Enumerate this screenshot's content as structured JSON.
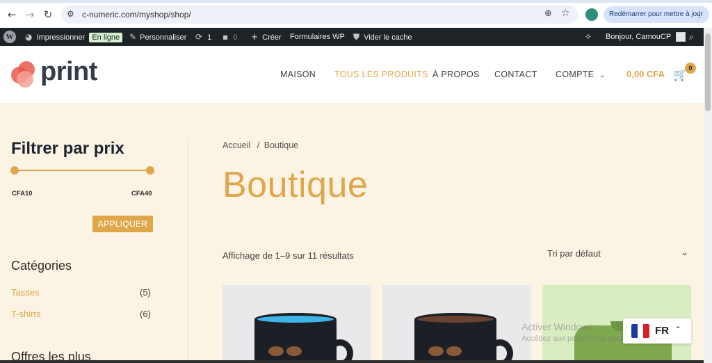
{
  "browser": {
    "back_icon": "arrow-left-icon",
    "forward_icon": "arrow-right-icon",
    "reload_icon": "reload-icon",
    "url": "c-numeric.com/myshop/shop/",
    "restart_label": "Redémarrer pour mettre à jour"
  },
  "adminbar": {
    "impressionner": "Impressionner",
    "online_badge": "En ligne",
    "personnaliser": "Personnaliser",
    "updates_count": "1",
    "comments_count": "0",
    "creer": "Créer",
    "formulaires": "Formulaires WP",
    "vider_cache": "Vider le cache",
    "greeting": "Bonjour, CamouCP"
  },
  "header": {
    "logo_text": "print",
    "menu": [
      "MAISON",
      "TOUS LES PRODUITS",
      "À PROPOS",
      "CONTACT",
      "COMPTE"
    ],
    "active_menu_index": 1,
    "cart_total": "0,00 CFA",
    "cart_count": "0"
  },
  "sidebar": {
    "filter_title": "Filtrer par prix",
    "price_min": "CFA10",
    "price_max": "CFA40",
    "apply_label": "APPLIQUER",
    "categories_title": "Catégories",
    "categories": [
      {
        "name": "Tasses",
        "count": "(5)"
      },
      {
        "name": "T-shirts",
        "count": "(6)"
      }
    ],
    "offers_title": "Offres les plus"
  },
  "main": {
    "breadcrumb_home": "Accueil",
    "breadcrumb_sep": "/",
    "breadcrumb_current": "Boutique",
    "page_title": "Boutique",
    "result_count": "Affichage de 1–9 sur 11 résultats",
    "sort_selected": "Tri par défaut"
  },
  "watermark": {
    "title": "Activer Windows",
    "subtitle": "Accédez aux paramètres pour activer Windows."
  },
  "language": {
    "code": "FR"
  },
  "colors": {
    "accent": "#e0a64b",
    "page_bg": "#fbf3e3",
    "adminbar_bg": "#1d2327"
  }
}
